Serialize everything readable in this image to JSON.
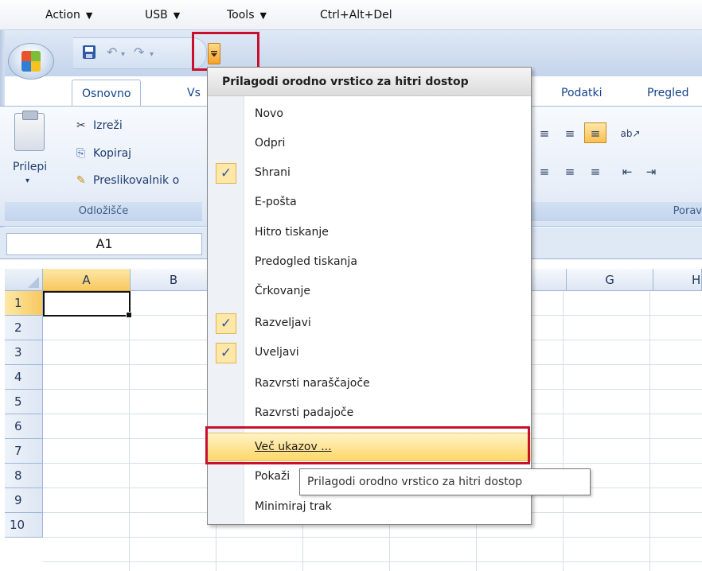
{
  "vm_menu": {
    "items": [
      {
        "label": "Action",
        "arrow": "▼"
      },
      {
        "label": "USB",
        "arrow": "▼"
      },
      {
        "label": "Tools",
        "arrow": "▼"
      },
      {
        "label": "Ctrl+Alt+Del",
        "arrow": ""
      }
    ]
  },
  "qat": {
    "undo_icon": "↶",
    "redo_icon": "↷",
    "dropdown_arrow": "▾",
    "separator": "·"
  },
  "tabs": {
    "home": "Osnovno",
    "insert_partial": "Vs",
    "data": "Podatki",
    "review_partial": "Pregled"
  },
  "ribbon": {
    "paste": "Prilepi",
    "paste_arrow": "▾",
    "cut": "Izreži",
    "copy": "Kopiraj",
    "format_painter": "Preslikovalnik o",
    "clipboard_group": "Odložišče",
    "alignment_group_partial": "Porav",
    "cut_icon": "✂",
    "copy_icon": "⎘",
    "brush_icon": "✎",
    "align_top": "≡",
    "align_middle": "≡",
    "align_bottom": "≡",
    "orientation": "ab↗",
    "align_left": "≡",
    "align_center": "≡",
    "align_right": "≡",
    "indent_dec": "⇤",
    "indent_inc": "⇥"
  },
  "name_box": {
    "value": "A1"
  },
  "sheet": {
    "columns": [
      "A",
      "B",
      "G",
      "H"
    ],
    "rows": [
      "1",
      "2",
      "3",
      "4",
      "5",
      "6",
      "7",
      "8",
      "9",
      "10"
    ]
  },
  "menu": {
    "title": "Prilagodi orodno vrstico za hitri dostop",
    "check_glyph": "✓",
    "items": [
      {
        "label": "Novo",
        "checked": false
      },
      {
        "label": "Odpri",
        "checked": false
      },
      {
        "label": "Shrani",
        "checked": true
      },
      {
        "label": "E-pošta",
        "checked": false
      },
      {
        "label": "Hitro tiskanje",
        "checked": false
      },
      {
        "label": "Predogled tiskanja",
        "checked": false
      },
      {
        "label": "Črkovanje",
        "checked": false
      },
      {
        "label": "Razveljavi",
        "checked": true
      },
      {
        "label": "Uveljavi",
        "checked": true
      },
      {
        "label": "Razvrsti naraščajoče",
        "checked": false
      },
      {
        "label": "Razvrsti padajoče",
        "checked": false
      },
      {
        "label": "Več ukazov ...",
        "checked": false
      },
      {
        "label": "Pokaži",
        "checked": false
      },
      {
        "label": "Minimiraj trak",
        "checked": false
      }
    ]
  },
  "tooltip": {
    "text": "Prilagodi orodno vrstico za hitri dostop"
  },
  "colors": {
    "highlight_border": "#c8102e",
    "hover_fill": "#fdd76b",
    "check_fill": "#fde8a8"
  }
}
